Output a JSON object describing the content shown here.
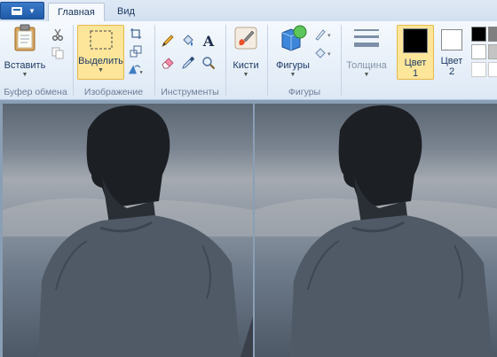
{
  "tabs": {
    "home": "Главная",
    "view": "Вид"
  },
  "clipboard": {
    "paste_label": "Вставить",
    "group_label": "Буфер обмена"
  },
  "image": {
    "select_label": "Выделить",
    "group_label": "Изображение"
  },
  "tools": {
    "group_label": "Инструменты"
  },
  "brushes": {
    "label": "Кисти"
  },
  "shapes": {
    "label": "Фигуры",
    "group_label": "Фигуры"
  },
  "thickness": {
    "label": "Толщина"
  },
  "colors": {
    "color1_label": "Цвет",
    "color1_num": "1",
    "color2_label": "Цвет",
    "color2_num": "2",
    "color1_value": "#000000",
    "color2_value": "#ffffff"
  },
  "accent": {
    "selected_bg": "#fde59a",
    "app_button": "#2a66b5"
  },
  "canvas": {
    "photo_description_icon": "man-back-portrait-photo"
  }
}
